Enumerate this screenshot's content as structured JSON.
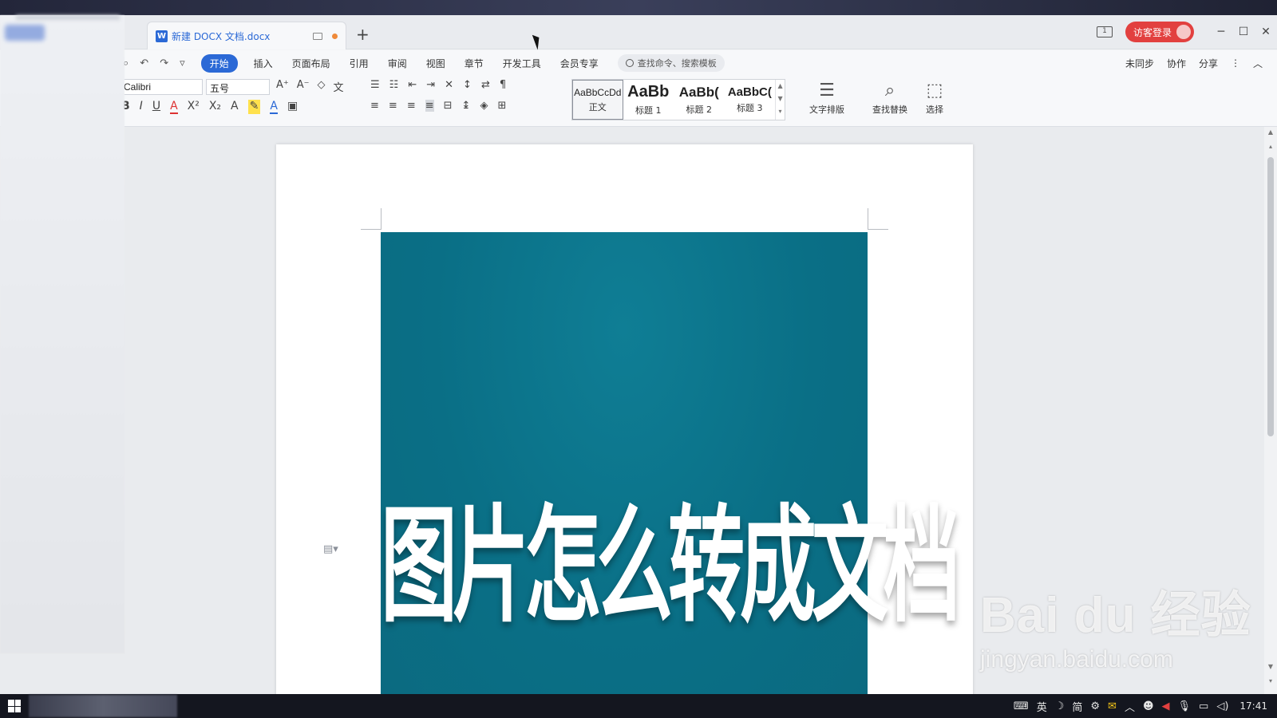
{
  "title_bar": {
    "tab_title": "新建 DOCX 文档.docx",
    "new_tab_label": "+",
    "login_label": "访客登录",
    "screen_indicator": "1",
    "window_controls": [
      "─",
      "☐",
      "✕"
    ]
  },
  "menu": {
    "items": [
      "开始",
      "插入",
      "页面布局",
      "引用",
      "审阅",
      "视图",
      "章节",
      "开发工具",
      "会员专享"
    ],
    "active": "开始",
    "search_placeholder": "查找命令、搜索模板",
    "right": [
      "未同步",
      "协作",
      "分享"
    ]
  },
  "ribbon": {
    "font_name": "Calibri",
    "font_size": "五号",
    "styles": [
      {
        "preview": "AaBbCcDd",
        "name": "正文"
      },
      {
        "preview": "AaBb",
        "name": "标题 1"
      },
      {
        "preview": "AaBb(",
        "name": "标题 2"
      },
      {
        "preview": "AaBbC(",
        "name": "标题 3"
      }
    ],
    "big_tools": [
      {
        "label": "文字排版",
        "icon": "text-layout-icon"
      },
      {
        "label": "查找替换",
        "icon": "find-replace-icon"
      },
      {
        "label": "选择",
        "icon": "select-icon"
      }
    ]
  },
  "document": {
    "image_text": "图片怎么转成文档",
    "image_bg_color": "#0b7389"
  },
  "watermark": {
    "brand": "Bai du 经验",
    "url": "jingyan.baidu.com"
  },
  "taskbar": {
    "ime": [
      "英",
      "简"
    ],
    "time": "17:41"
  },
  "colors": {
    "accent": "#2b69d6",
    "login": "#e2403f",
    "unsaved_dot": "#ef8a3a"
  }
}
